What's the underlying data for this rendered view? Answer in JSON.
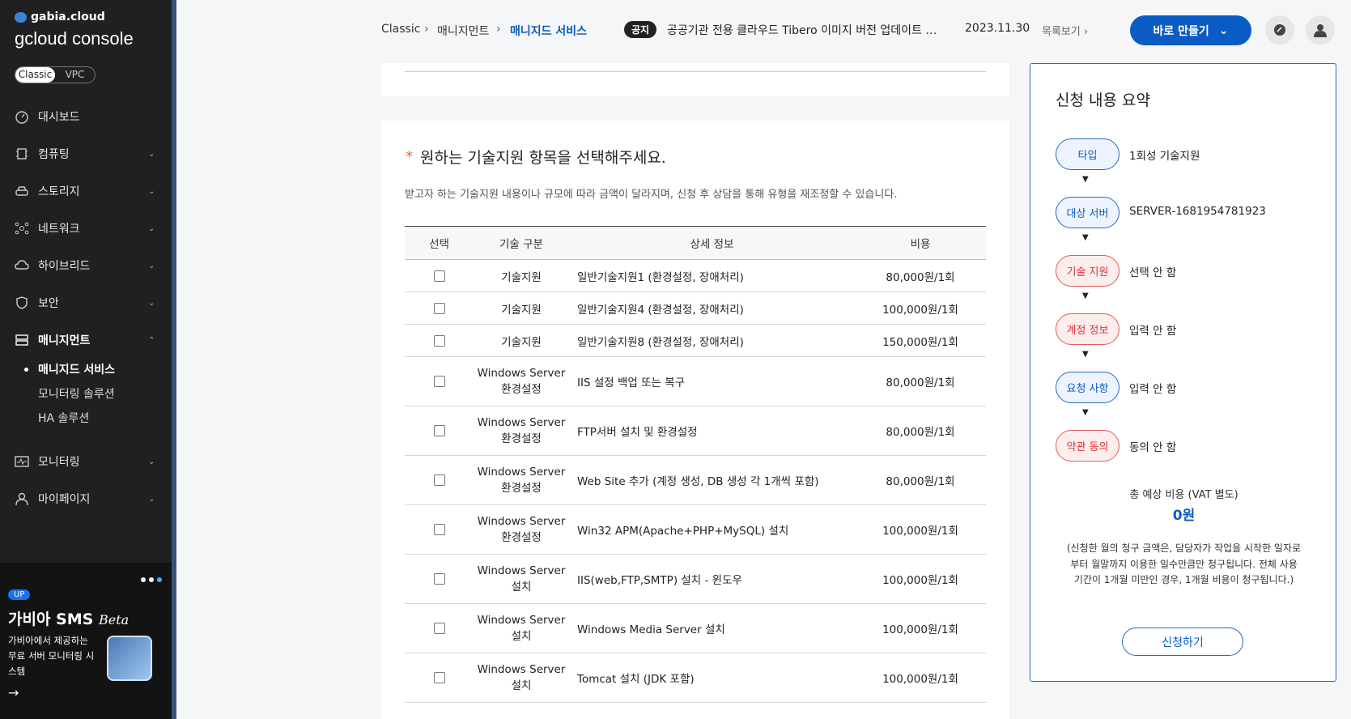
{
  "sidebar": {
    "brand_small": "gabia.cloud",
    "brand_big": "gcloud console",
    "toggle": [
      "Classic",
      "VPC"
    ],
    "items": [
      {
        "label": "대시보드",
        "icon": "dashboard-icon"
      },
      {
        "label": "컴퓨팅",
        "icon": "cpu-icon"
      },
      {
        "label": "스토리지",
        "icon": "storage-icon"
      },
      {
        "label": "네트워크",
        "icon": "network-icon"
      },
      {
        "label": "하이브리드",
        "icon": "hybrid-icon"
      },
      {
        "label": "보안",
        "icon": "shield-icon"
      },
      {
        "label": "매니지먼트",
        "icon": "management-icon"
      },
      {
        "label": "모니터링",
        "icon": "monitoring-icon"
      },
      {
        "label": "마이페이지",
        "icon": "user-icon"
      }
    ],
    "sub_items": [
      "매니지드 서비스",
      "모니터링 솔루션",
      "HA 솔루션"
    ],
    "promo": {
      "badge": "UP",
      "title": "가비아 SMS",
      "beta": "Beta",
      "desc": "가비아에서 제공하는 무료 서버 모니터링 시스템"
    }
  },
  "header": {
    "breadcrumb": [
      "Classic",
      "매니지먼트",
      "매니지드 서비스"
    ],
    "notice_badge": "공지",
    "notice_text": "공공기관 전용 클라우드 Tibero 이미지 버전 업데이트 …",
    "notice_date": "2023.11.30",
    "notice_list": "목록보기",
    "create_button": "바로 만들기"
  },
  "main": {
    "section_title": "원하는 기술지원 항목을 선택해주세요.",
    "required_mark": "*",
    "section_desc": "받고자 하는 기술지원 내용이나 규모에 따라 금액이 달라지며, 신청 후 상담을 통해 유형을 재조정할 수 있습니다.",
    "columns": [
      "선택",
      "기술 구분",
      "상세 정보",
      "비용"
    ],
    "rows": [
      {
        "category": "기술지원",
        "detail": "일반기술지원1 (환경설정, 장애처리)",
        "cost": "80,000원/1회"
      },
      {
        "category": "기술지원",
        "detail": "일반기술지원4 (환경설정, 장애처리)",
        "cost": "100,000원/1회"
      },
      {
        "category": "기술지원",
        "detail": "일반기술지원8 (환경설정, 장애처리)",
        "cost": "150,000원/1회"
      },
      {
        "category": "Windows Server 환경설정",
        "detail": "IIS 설정 백업 또는 복구",
        "cost": "80,000원/1회"
      },
      {
        "category": "Windows Server 환경설정",
        "detail": "FTP서버 설치 및 환경설정",
        "cost": "80,000원/1회"
      },
      {
        "category": "Windows Server 환경설정",
        "detail": "Web Site 추가 (계정 생성, DB 생성 각 1개씩 포함)",
        "cost": "80,000원/1회"
      },
      {
        "category": "Windows Server 환경설정",
        "detail": "Win32 APM(Apache+PHP+MySQL) 설치",
        "cost": "100,000원/1회"
      },
      {
        "category": "Windows Server 설치",
        "detail": "IIS(web,FTP,SMTP) 설치 - 윈도우",
        "cost": "100,000원/1회"
      },
      {
        "category": "Windows Server 설치",
        "detail": "Windows Media Server 설치",
        "cost": "100,000원/1회"
      },
      {
        "category": "Windows Server 설치",
        "detail": "Tomcat 설치 (JDK 포함)",
        "cost": "100,000원/1회"
      }
    ]
  },
  "summary": {
    "title": "신청 내용 요약",
    "steps": [
      {
        "label": "타입",
        "value": "1회성 기술지원",
        "state": "done"
      },
      {
        "label": "대상 서버",
        "value": "SERVER-1681954781923",
        "state": "done"
      },
      {
        "label": "기술 지원",
        "value": "선택 안 함",
        "state": "missing"
      },
      {
        "label": "계정 정보",
        "value": "입력 안 함",
        "state": "missing"
      },
      {
        "label": "요청 사항",
        "value": "입력 안 함",
        "state": "done"
      },
      {
        "label": "약관 동의",
        "value": "동의 안 함",
        "state": "missing"
      }
    ],
    "total_label": "총 예상 비용 (VAT 별도)",
    "total_value": "0원",
    "note": "(신청한 월의 청구 금액은, 담당자가 작업을 시작한 일자로부터 월말까지 이용한 일수만큼만 청구됩니다. 전체 사용 기간이 1개월 미만인 경우, 1개월 비용이 청구됩니다.)",
    "apply_button": "신청하기"
  },
  "colors": {
    "accent": "#0a5bc4",
    "warning": "#e05a5a",
    "sidebar": "#202020"
  }
}
